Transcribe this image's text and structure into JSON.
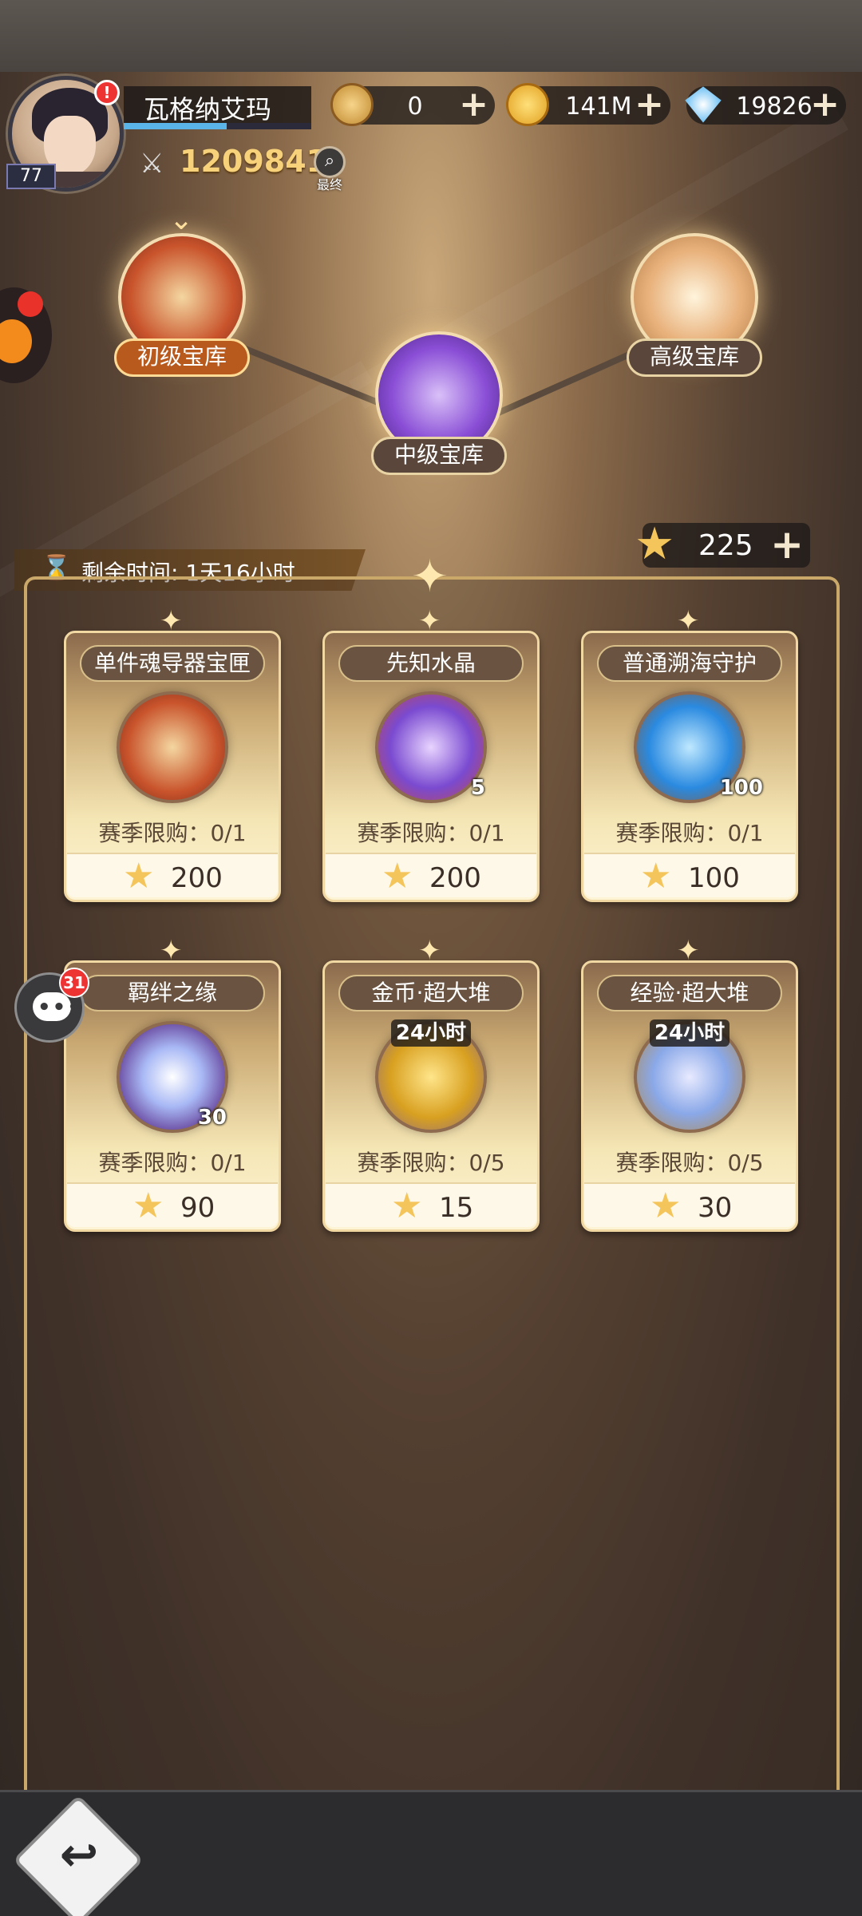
{
  "player": {
    "name": "瓦格纳艾玛",
    "level": "77",
    "exp_progress": 0.55,
    "alert": "!",
    "power": "1209841",
    "search_label": "最终"
  },
  "resources": [
    {
      "icon": "gold-token-icon",
      "value": "0",
      "plus": "+"
    },
    {
      "icon": "coin-icon",
      "value": "141M",
      "plus": "+"
    },
    {
      "icon": "diamond-icon",
      "value": "19826",
      "plus": "+"
    }
  ],
  "vaults": {
    "junior": "初级宝库",
    "middle": "中级宝库",
    "senior": "高级宝库"
  },
  "timer": {
    "label": "剩余时间: 1天16小时"
  },
  "star_currency": {
    "value": "225",
    "plus": "+"
  },
  "shop_items": [
    {
      "title": "单件魂导器宝匣",
      "count": "",
      "tag": "",
      "limit": "赛季限购：0/1",
      "price": "200",
      "icon": "treasure-chest-icon"
    },
    {
      "title": "先知水晶",
      "count": "5",
      "tag": "",
      "limit": "赛季限购：0/1",
      "price": "200",
      "icon": "crystal-ball-icon"
    },
    {
      "title": "普通溯海守护",
      "count": "100",
      "tag": "",
      "limit": "赛季限购：0/1",
      "price": "100",
      "icon": "trident-icon"
    },
    {
      "title": "羁绊之缘",
      "count": "30",
      "tag": "",
      "limit": "赛季限购：0/1",
      "price": "90",
      "icon": "compass-star-icon"
    },
    {
      "title": "金币·超大堆",
      "count": "",
      "tag": "24小时",
      "limit": "赛季限购：0/5",
      "price": "15",
      "icon": "gold-pile-icon"
    },
    {
      "title": "经验·超大堆",
      "count": "",
      "tag": "24小时",
      "limit": "赛季限购：0/5",
      "price": "30",
      "icon": "exp-potion-pile-icon"
    }
  ],
  "chat": {
    "badge": "31"
  },
  "colors": {
    "accent_gold": "#f7d27a",
    "card_cream": "#fdf4d6",
    "alert_red": "#e33"
  }
}
